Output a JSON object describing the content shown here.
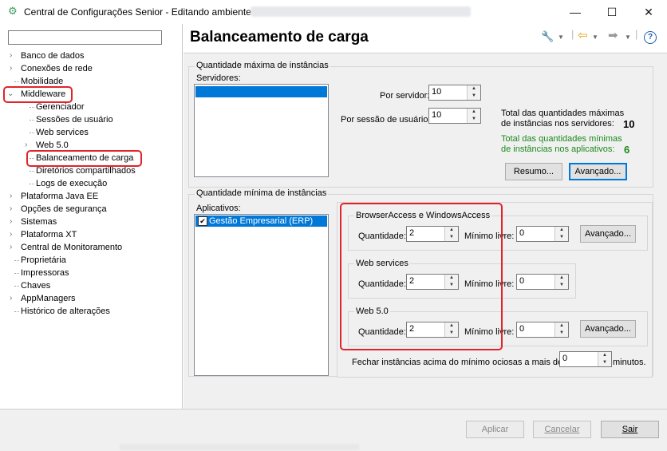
{
  "window": {
    "title": "Central de Configurações Senior - Editando ambiente",
    "minimize": "—",
    "maximize": "☐",
    "close": "✕"
  },
  "tree": {
    "search_value": "",
    "items": [
      {
        "label": "Banco de dados"
      },
      {
        "label": "Conexões de rede"
      },
      {
        "label": "Mobilidade"
      },
      {
        "label": "Middleware"
      },
      {
        "label": "Gerenciador"
      },
      {
        "label": "Sessões de usuário"
      },
      {
        "label": "Web services"
      },
      {
        "label": "Web 5.0"
      },
      {
        "label": "Balanceamento de carga"
      },
      {
        "label": "Diretórios compartilhados"
      },
      {
        "label": "Logs de execução"
      },
      {
        "label": "Plataforma Java EE"
      },
      {
        "label": "Opções de segurança"
      },
      {
        "label": "Sistemas"
      },
      {
        "label": "Plataforma XT"
      },
      {
        "label": "Central de Monitoramento"
      },
      {
        "label": "Proprietária"
      },
      {
        "label": "Impressoras"
      },
      {
        "label": "Chaves"
      },
      {
        "label": "AppManagers"
      },
      {
        "label": "Histórico de alterações"
      }
    ]
  },
  "page": {
    "title": "Balanceamento de carga"
  },
  "max_group": {
    "title": "Quantidade máxima de instâncias",
    "servers_label": "Servidores:",
    "por_servidor_label": "Por servidor:",
    "por_servidor_value": "10",
    "por_sessao_label": "Por sessão de usuário:",
    "por_sessao_value": "10",
    "total_max_text1": "Total das quantidades máximas",
    "total_max_text2": "de instâncias nos servidores:",
    "total_max_value": "10",
    "total_min_text1": "Total das quantidades mínimas",
    "total_min_text2": "de instâncias nos aplicativos:",
    "total_min_value": "6",
    "resumo_label": "Resumo...",
    "avancado_label": "Avançado..."
  },
  "min_group": {
    "title": "Quantidade mínima de instâncias",
    "apps_label": "Aplicativos:",
    "app_item": "Gestão Empresarial (ERP)",
    "sub": [
      {
        "title": "BrowserAccess e WindowsAccess",
        "qty_label": "Quantidade:",
        "qty": "2",
        "min_label": "Mínimo livre:",
        "min": "0",
        "btn": "Avançado..."
      },
      {
        "title": "Web services",
        "qty_label": "Quantidade:",
        "qty": "2",
        "min_label": "Mínimo livre:",
        "min": "0"
      },
      {
        "title": "Web 5.0",
        "qty_label": "Quantidade:",
        "qty": "2",
        "min_label": "Mínimo livre:",
        "min": "0",
        "btn": "Avançado..."
      }
    ],
    "fechar_label": "Fechar instâncias acima do mínimo ociosas a mais de",
    "fechar_value": "0",
    "minutos_label": "minutos."
  },
  "footer": {
    "aplicar": "Aplicar",
    "cancelar": "Cancelar",
    "sair": "Sair"
  },
  "colors": {
    "highlight": "#e0242a",
    "selection": "#0078d7",
    "total_min": "#1a8a1a"
  }
}
